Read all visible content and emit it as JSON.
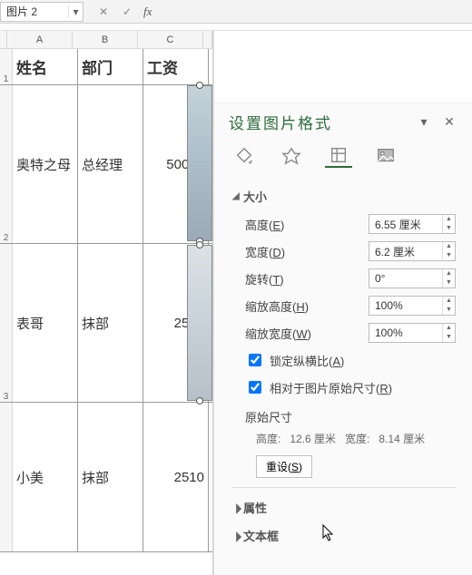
{
  "namebox": {
    "value": "图片 2"
  },
  "fbar": {
    "cancel": "✕",
    "confirm": "✓",
    "fx": "fx"
  },
  "cols": [
    "A",
    "B",
    "C"
  ],
  "rownums": [
    "1",
    "2",
    "3"
  ],
  "table": {
    "headers": [
      "姓名",
      "部门",
      "工资"
    ],
    "rows": [
      {
        "name": "奥特之母",
        "dept": "总经理",
        "salary": "50000"
      },
      {
        "name": "表哥",
        "dept": "抹部",
        "salary": "2500"
      },
      {
        "name": "小美",
        "dept": "抹部",
        "salary": "2510"
      }
    ]
  },
  "panel": {
    "title": "设置图片格式",
    "sections": {
      "size_label": "大小",
      "attrs_label": "属性",
      "textbox_label": "文本框"
    },
    "fields": {
      "height": {
        "label": "高度(",
        "accel": "E",
        "label2": ")",
        "value": "6.55 厘米"
      },
      "width": {
        "label": "宽度(",
        "accel": "D",
        "label2": ")",
        "value": "6.2 厘米"
      },
      "rotate": {
        "label": "旋转(",
        "accel": "T",
        "label2": ")",
        "value": "0°"
      },
      "scaleh": {
        "label": "缩放高度(",
        "accel": "H",
        "label2": ")",
        "value": "100%"
      },
      "scalew": {
        "label": "缩放宽度(",
        "accel": "W",
        "label2": ")",
        "value": "100%"
      }
    },
    "checks": {
      "lock": {
        "label": "锁定纵横比(",
        "accel": "A",
        "label2": ")",
        "checked": true
      },
      "relative": {
        "label": "相对于图片原始尺寸(",
        "accel": "R",
        "label2": ")",
        "checked": true
      }
    },
    "orig": {
      "title": "原始尺寸",
      "h_label": "高度:",
      "h_val": "12.6 厘米",
      "w_label": "宽度:",
      "w_val": "8.14 厘米"
    },
    "reset": {
      "label": "重设(",
      "accel": "S",
      "label2": ")"
    }
  }
}
